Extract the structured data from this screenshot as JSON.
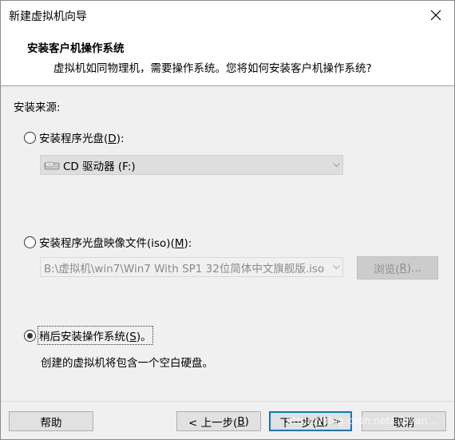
{
  "window": {
    "title": "新建虚拟机向导"
  },
  "header": {
    "title": "安装客户机操作系统",
    "subtitle": "虚拟机如同物理机，需要操作系统。您将如何安装客户机操作系统?"
  },
  "install_source": {
    "label": "安装来源:",
    "options": [
      {
        "label_pre": "安装程序光盘(",
        "accesskey": "D",
        "label_post": "):",
        "selected": false
      },
      {
        "label_pre": "安装程序光盘映像文件(iso)(",
        "accesskey": "M",
        "label_post": "):",
        "selected": false
      },
      {
        "label_pre": "稍后安装操作系统(",
        "accesskey": "S",
        "label_post": ")。",
        "selected": true
      }
    ],
    "cd_drive": {
      "value": "CD 驱动器 (F:)",
      "icon": "cd-drive-icon"
    },
    "iso_path": {
      "value": "B:\\虚拟机\\win7\\Win7 With SP1 32位简体中文旗舰版.iso"
    },
    "browse_button": {
      "label_pre": "浏览(",
      "accesskey": "R",
      "label_post": ")..."
    },
    "later_note": "创建的虚拟机将包含一个空白硬盘。"
  },
  "footer": {
    "help_label": "帮助",
    "back": {
      "label_pre": "< 上一步(",
      "accesskey": "B",
      "label_post": ")"
    },
    "next": {
      "label_pre": "下一步(",
      "accesskey": "N",
      "label_post": ") >"
    },
    "cancel_label": "取消"
  },
  "watermark": "https://blog.csdn.net/...oyan..."
}
